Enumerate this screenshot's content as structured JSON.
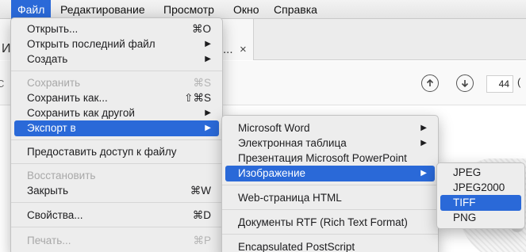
{
  "menubar": {
    "items": [
      "Файл",
      "Редактирование",
      "Просмотр",
      "Окно",
      "Справка"
    ]
  },
  "background": {
    "tab_title": "И",
    "tab_ellipsis": "...",
    "tab_close": "×",
    "left_fragment": "С",
    "page_number": "44",
    "page_paren": "("
  },
  "file_menu": {
    "items": [
      {
        "label": "Открыть...",
        "shortcut": "⌘O"
      },
      {
        "label": "Открыть последний файл",
        "submenu": true
      },
      {
        "label": "Создать",
        "submenu": true
      },
      {
        "label": "Сохранить",
        "shortcut": "⌘S",
        "disabled": true
      },
      {
        "label": "Сохранить как...",
        "shortcut": "⇧⌘S"
      },
      {
        "label": "Сохранить как другой",
        "submenu": true
      },
      {
        "label": "Экспорт в",
        "submenu": true,
        "highlighted": true
      },
      {
        "label": "Предоставить доступ к файлу"
      },
      {
        "label": "Восстановить",
        "disabled": true
      },
      {
        "label": "Закрыть",
        "shortcut": "⌘W"
      },
      {
        "label": "Свойства...",
        "shortcut": "⌘D"
      },
      {
        "label": "Печать...",
        "shortcut": "⌘P",
        "disabled": true
      }
    ],
    "arrow": "▶"
  },
  "export_menu": {
    "items": [
      {
        "label": "Microsoft Word",
        "submenu": true
      },
      {
        "label": "Электронная таблица",
        "submenu": true
      },
      {
        "label": "Презентация Microsoft PowerPoint"
      },
      {
        "label": "Изображение",
        "submenu": true,
        "highlighted": true
      },
      {
        "label": "Web-страница HTML"
      },
      {
        "label": "Документы RTF (Rich Text Format)"
      },
      {
        "label": "Encapsulated PostScript"
      }
    ]
  },
  "image_menu": {
    "items": [
      {
        "label": "JPEG"
      },
      {
        "label": "JPEG2000"
      },
      {
        "label": "TIFF",
        "highlighted": true
      },
      {
        "label": "PNG"
      }
    ]
  },
  "colors": {
    "highlight": "#2a69d8",
    "menu_bg": "#ededed",
    "disabled_text": "#a8a8a8"
  }
}
